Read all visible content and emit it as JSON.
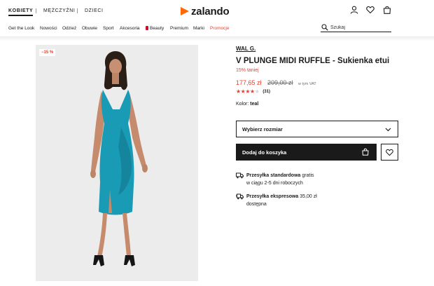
{
  "header": {
    "genders": [
      "KOBIETY",
      "MĘŻCZYŹNI",
      "DZIECI"
    ],
    "logo_text": "zalando",
    "icons": [
      "user-icon",
      "heart-icon",
      "bag-icon"
    ]
  },
  "nav": {
    "categories": [
      "Get the Look",
      "Nowości",
      "Odzież",
      "Obuwie",
      "Sport",
      "Akcesoria",
      "Beauty",
      "Premium",
      "Marki",
      "Promocje"
    ],
    "search_placeholder": "Szukaj"
  },
  "product": {
    "badge": "−15 %",
    "brand": "WAL G.",
    "title": "V PLUNGE MIDI RUFFLE - Sukienka etui",
    "discount_text": "15% taniej",
    "price": "177,65 zł",
    "old_price": "209,00 zł",
    "vat_note": "w tym VAT",
    "rating_stars": 4.5,
    "rating_count": "(31)",
    "color_label": "Kolor:",
    "color_value": "teal",
    "size_select": "Wybierz rozmiar",
    "add_to_cart": "Dodaj do koszyka",
    "accent_color": "#e8402f",
    "dress_color": "#1a9bb5"
  },
  "shipping": [
    {
      "title": "Przesyłka standardowa",
      "price": "gratis",
      "detail": "w ciągu 2-5 dni roboczych",
      "icon": "truck-icon"
    },
    {
      "title": "Przesyłka ekspresowa",
      "price": "35,00 zł",
      "detail": "dostępna",
      "icon": "fast-truck-icon"
    }
  ]
}
